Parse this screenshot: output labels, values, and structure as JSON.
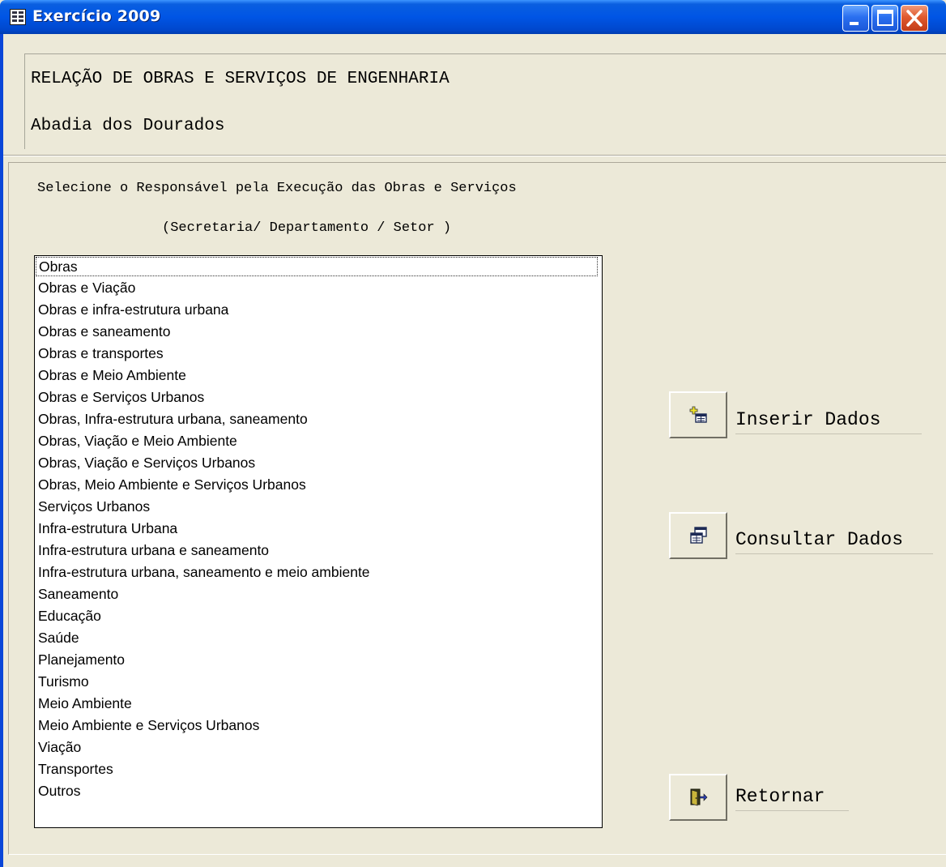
{
  "window": {
    "title": "Exercício 2009",
    "icons": {
      "app": "form-icon",
      "minimize": "minimize-icon",
      "maximize": "maximize-icon",
      "close": "close-icon"
    }
  },
  "header": {
    "title": "RELAÇÃO DE OBRAS E SERVIÇOS DE ENGENHARIA",
    "municipality": "Abadia dos Dourados"
  },
  "instructions": {
    "line1": "Selecione o  Responsável pela Execução das Obras e Serviços",
    "line2": "(Secretaria/ Departamento / Setor )"
  },
  "list": {
    "selected_index": 0,
    "items": [
      "Obras",
      "Obras e Viação",
      "Obras e infra-estrutura urbana",
      "Obras e saneamento",
      "Obras e transportes",
      "Obras e Meio Ambiente",
      "Obras e Serviços Urbanos",
      "Obras, Infra-estrutura urbana, saneamento",
      "Obras, Viação e Meio Ambiente",
      "Obras, Viação e Serviços Urbanos",
      "Obras, Meio Ambiente e Serviços Urbanos",
      "Serviços Urbanos",
      "Infra-estrutura Urbana",
      "Infra-estrutura urbana e saneamento",
      "Infra-estrutura urbana, saneamento e meio ambiente",
      "Saneamento",
      "Educação",
      "Saúde",
      "Planejamento",
      "Turismo",
      "Meio Ambiente",
      "Meio Ambiente e Serviços Urbanos",
      "Viação",
      "Transportes",
      "Outros"
    ]
  },
  "actions": {
    "insert": {
      "label": "Inserir Dados",
      "icon": "insert-record-icon"
    },
    "consult": {
      "label": "Consultar Dados",
      "icon": "view-records-icon"
    },
    "back": {
      "label": "Retornar",
      "icon": "exit-door-icon"
    }
  }
}
